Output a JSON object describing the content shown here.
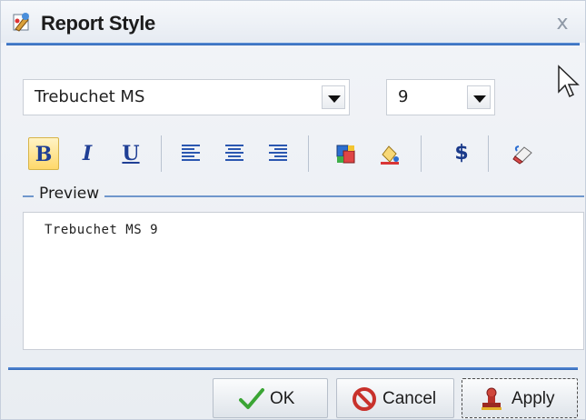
{
  "dialog": {
    "title": "Report Style",
    "close_label": "x"
  },
  "font": {
    "family_value": "Trebuchet MS",
    "size_value": "9"
  },
  "toolbar": {
    "bold": "B",
    "italic": "I",
    "underline": "U",
    "currency": "$",
    "icons": [
      "bold-icon",
      "italic-icon",
      "underline-icon",
      "align-left-icon",
      "align-center-icon",
      "align-right-icon",
      "fill-color-icon",
      "font-color-icon",
      "currency-icon",
      "eraser-icon"
    ]
  },
  "preview": {
    "legend": "Preview",
    "text": "Trebuchet MS 9"
  },
  "buttons": {
    "ok": "OK",
    "cancel": "Cancel",
    "apply": "Apply"
  },
  "colors": {
    "accent": "#2f66b8",
    "active_button": "#ffd86a"
  }
}
